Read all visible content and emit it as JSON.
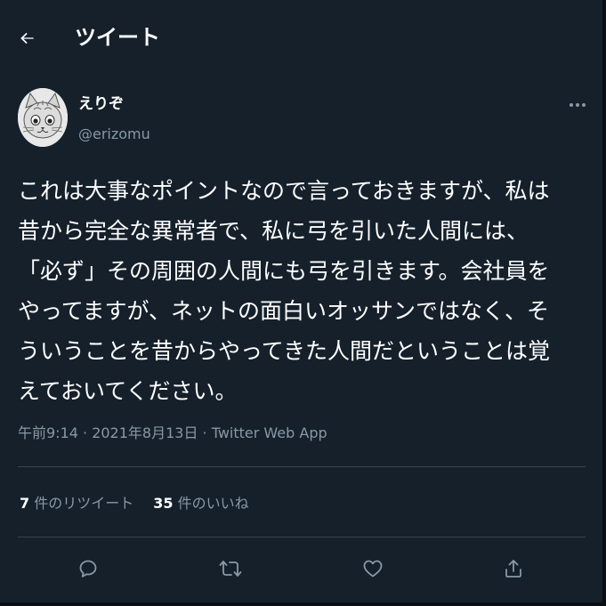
{
  "header": {
    "back_icon": "arrow-left-icon",
    "title": "ツイート"
  },
  "author": {
    "display_name": "えりぞ",
    "handle": "@erizomu",
    "avatar": "cat-drawing-avatar"
  },
  "tweet": {
    "lines": [
      "これは大事なポイントなので言っておきますが、私は",
      "昔から完全な異常者で、私に弓を引いた人間には、",
      "「必ず」その周囲の人間にも弓を引きます。会社員を",
      "やってますが、ネットの面白いオッサンではなく、そ",
      "ういうことを昔からやってきた人間だということは覚",
      "えておいてください。"
    ],
    "time": "午前9:14 · 2021年8月13日 · Twitter Web App"
  },
  "stats": {
    "retweet_count": "7",
    "retweet_label": "件のリツイート",
    "like_count": "35",
    "like_label": "件のいいね"
  },
  "actions": [
    {
      "icon": "reply-icon"
    },
    {
      "icon": "retweet-icon"
    },
    {
      "icon": "like-icon"
    },
    {
      "icon": "share-icon"
    }
  ],
  "colors": {
    "background": "#15202b",
    "text": "#ffffff",
    "secondary": "#8899a6",
    "divider": "#38444d"
  }
}
